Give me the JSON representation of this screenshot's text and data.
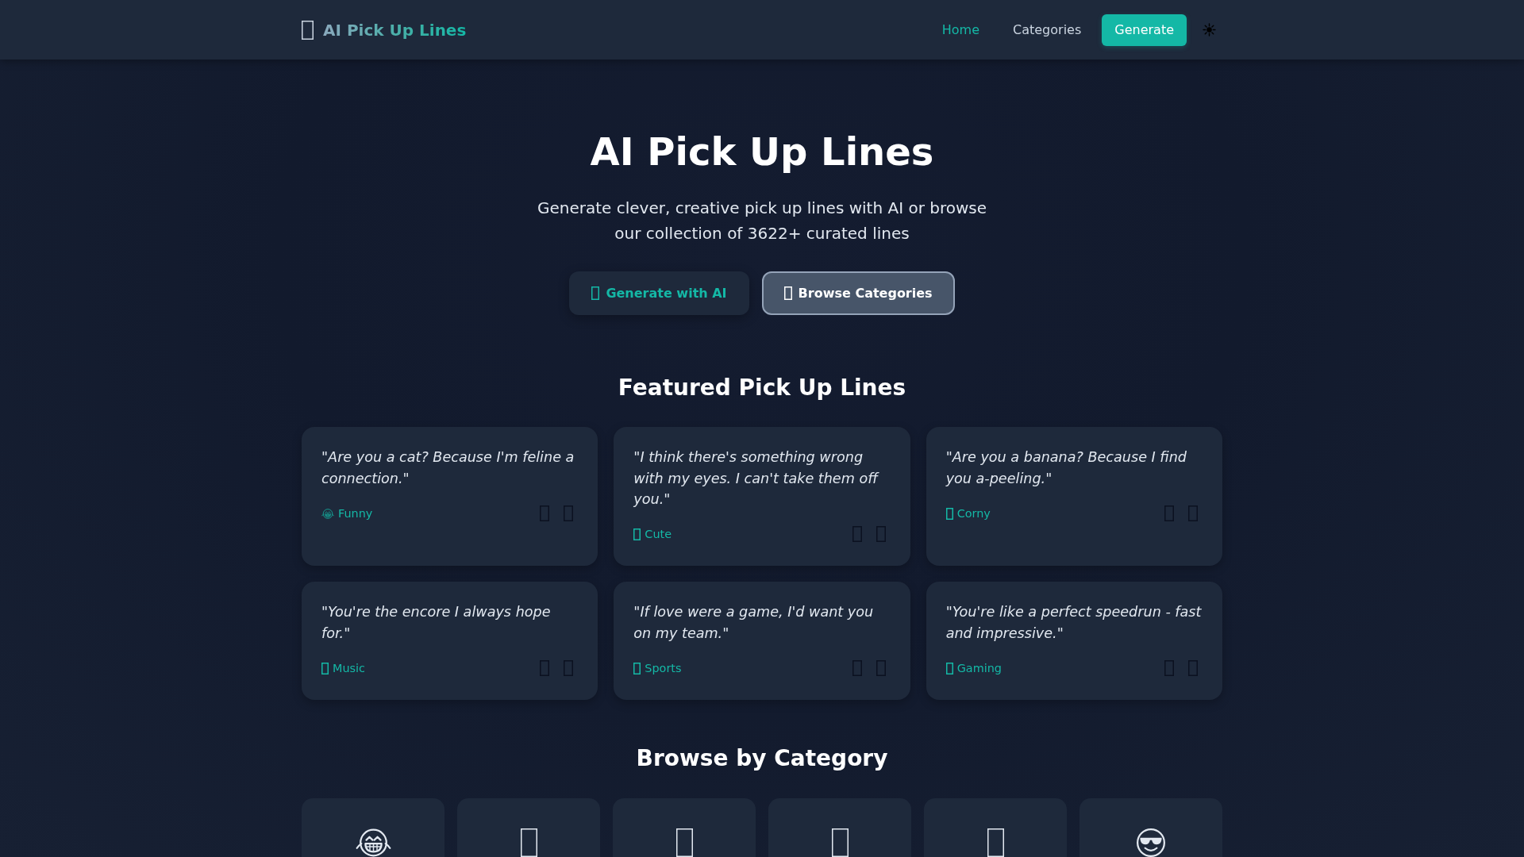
{
  "header": {
    "logo": "AI Pick Up Lines",
    "nav": [
      {
        "label": "Home",
        "kind": "link",
        "selected": true
      },
      {
        "label": "Categories",
        "kind": "link",
        "selected": false
      },
      {
        "label": "Generate",
        "kind": "button",
        "selected": false
      }
    ]
  },
  "hero": {
    "title": "AI Pick Up Lines",
    "subtitle": "Generate clever, creative pick up lines with AI or browse our collection of 3622+ curated lines",
    "buttons": [
      {
        "label": "Generate with AI",
        "kind": "filled"
      },
      {
        "label": "Browse Categories",
        "kind": "outline"
      }
    ]
  },
  "featured": {
    "title": "Featured Pick Up Lines",
    "lines": [
      {
        "text": "\"Are you a cat? Because I'm feline a connection.\"",
        "tag": {
          "label": "Funny",
          "kind": "laughing"
        }
      },
      {
        "text": "\"I think there's something wrong with my eyes. I can't take them off you.\"",
        "tag": {
          "label": "Cute",
          "kind": "glyph-box"
        }
      },
      {
        "text": "\"Are you a banana? Because I find you a-peeling.\"",
        "tag": {
          "label": "Corny",
          "kind": "glyph-box"
        }
      },
      {
        "text": "\"You're the encore I always hope for.\"",
        "tag": {
          "label": "Music",
          "kind": "glyph-box"
        }
      },
      {
        "text": "\"If love were a game, I'd want you on my team.\"",
        "tag": {
          "label": "Sports",
          "kind": "glyph-box"
        }
      },
      {
        "text": "\"You're like a perfect speedrun - fast and impressive.\"",
        "tag": {
          "label": "Gaming",
          "kind": "glyph-box"
        }
      }
    ]
  },
  "categories": {
    "title": "Browse by Category",
    "items": [
      {
        "kind": "laughing"
      },
      {
        "kind": "glyph-box"
      },
      {
        "kind": "glyph-box"
      },
      {
        "kind": "glyph-box"
      },
      {
        "kind": "glyph-box"
      },
      {
        "kind": "sunglasses"
      }
    ]
  }
}
